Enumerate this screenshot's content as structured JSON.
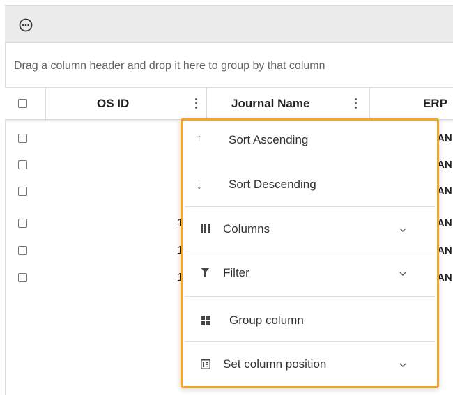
{
  "toolbar": {
    "more_icon": "more-horizontal-circle-icon"
  },
  "group_panel": {
    "text": "Drag a column header and drop it here to group by that column"
  },
  "columns": [
    {
      "title": "OS ID"
    },
    {
      "title": "Journal Name"
    },
    {
      "title": "ERP"
    }
  ],
  "rows": [
    {
      "num": "",
      "erp": "AN"
    },
    {
      "num": "",
      "erp": "AN"
    },
    {
      "num": "",
      "erp": "AN"
    },
    {
      "num": "1",
      "erp": "AN"
    },
    {
      "num": "1",
      "erp": "AN"
    },
    {
      "num": "1",
      "erp": "AN"
    }
  ],
  "menu": {
    "sort_asc": {
      "icon": "↑",
      "label": "Sort Ascending"
    },
    "sort_desc": {
      "icon": "↓",
      "label": "Sort Descending"
    },
    "columns": {
      "label": "Columns"
    },
    "filter": {
      "label": "Filter"
    },
    "group": {
      "label": "Group column"
    },
    "position": {
      "label": "Set column position"
    }
  },
  "colors": {
    "highlight": "#f5a623",
    "toolbar_bg": "#ececec"
  }
}
